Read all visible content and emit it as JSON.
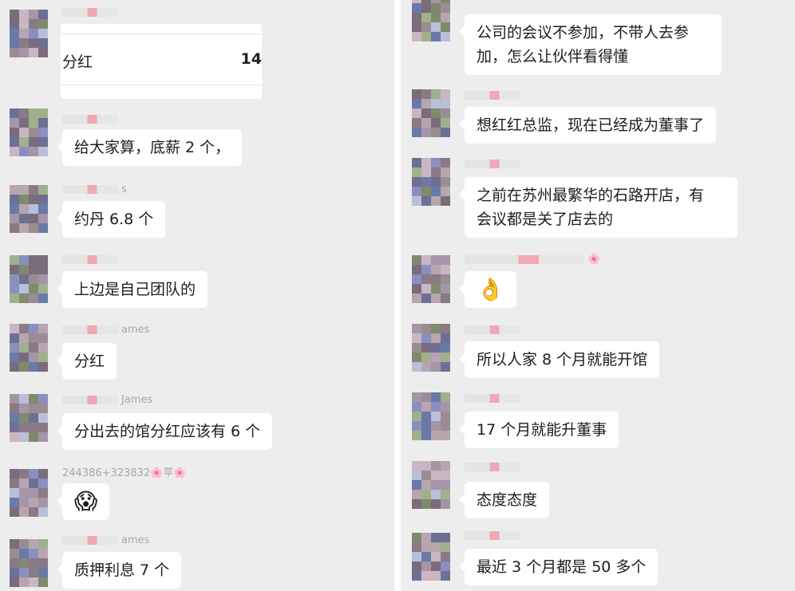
{
  "left": {
    "card": {
      "label": "分红",
      "value": "14"
    },
    "messages": [
      {
        "name": "",
        "text": "给大家算，底薪 2 个，"
      },
      {
        "name": "s",
        "text": "约丹 6.8 个"
      },
      {
        "name": "",
        "text": "上边是自己团队的"
      },
      {
        "name": "ames",
        "text": "分红"
      },
      {
        "name": "James",
        "text": "分出去的馆分红应该有 6 个"
      },
      {
        "name": "244386+323832🌸苹🌸",
        "text": "😱"
      },
      {
        "name": "ames",
        "text": "质押利息 7 个"
      }
    ]
  },
  "right": {
    "messages": [
      {
        "name": "",
        "text": "公司的会议不参加，不带人去参\n加，怎么让伙伴看得懂"
      },
      {
        "name": "",
        "text": "想红红总监，现在已经成为董事了"
      },
      {
        "name": "",
        "text": "之前在苏州最繁华的石路开店，有\n会议都是关了店去的"
      },
      {
        "name": "🌸",
        "text": "👌"
      },
      {
        "name": "",
        "text": "所以人家 8 个月就能开馆"
      },
      {
        "name": "",
        "text": "17 个月就能升董事"
      },
      {
        "name": "",
        "text": "态度态度"
      },
      {
        "name": "",
        "text": "最近 3 个月都是 50 多个"
      }
    ]
  }
}
